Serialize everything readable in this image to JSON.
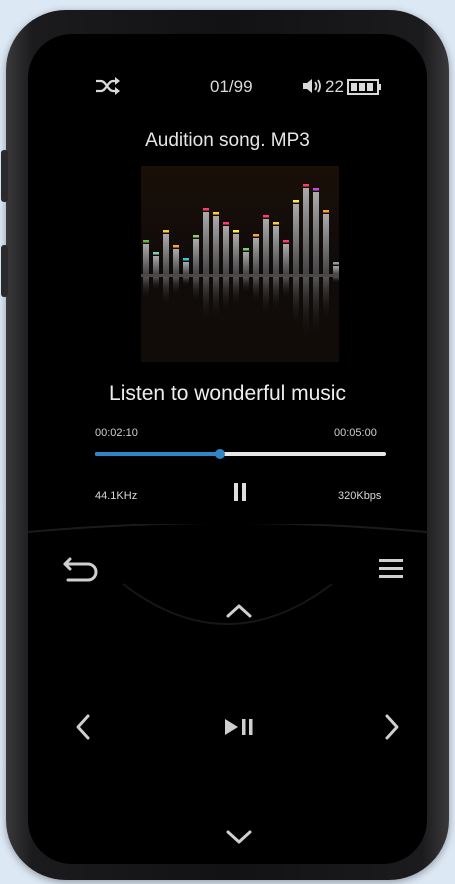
{
  "status": {
    "track_counter": "01/99",
    "volume": "22",
    "shuffle_icon": "shuffle-icon",
    "volume_icon": "speaker-icon",
    "battery_icon": "battery-icon"
  },
  "player": {
    "song_title": "Audition song. MP3",
    "tagline": "Listen to wonderful music",
    "elapsed": "00:02:10",
    "total": "00:05:00",
    "progress": 0.43,
    "sample_rate": "44.1KHz",
    "bitrate": "320Kbps",
    "play_state_icon": "pause-icon"
  },
  "controls": {
    "back_icon": "back-icon",
    "menu_icon": "menu-icon",
    "up_icon": "chevron-up-icon",
    "down_icon": "chevron-down-icon",
    "left_icon": "chevron-left-icon",
    "right_icon": "chevron-right-icon",
    "play_pause_icon": "play-pause-icon"
  },
  "colors": {
    "accent": "#2e86c8",
    "track": "#e8e8e8",
    "background": "#000000"
  }
}
